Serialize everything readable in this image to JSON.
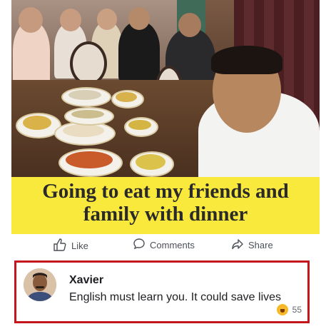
{
  "post": {
    "caption_line1": "Going to eat my friends and",
    "caption_line2": "family with dinner"
  },
  "actions": {
    "like_label": "Like",
    "comments_label": "Comments",
    "share_label": "Share"
  },
  "comment": {
    "author": "Xavier",
    "text": "English must learn you. It could save lives",
    "reaction_count": "55",
    "reaction_icon": "laughing-emoji-icon"
  },
  "colors": {
    "caption_bg": "#f9e93c",
    "comment_border": "#c4161c",
    "action_text": "#4b4f56"
  }
}
